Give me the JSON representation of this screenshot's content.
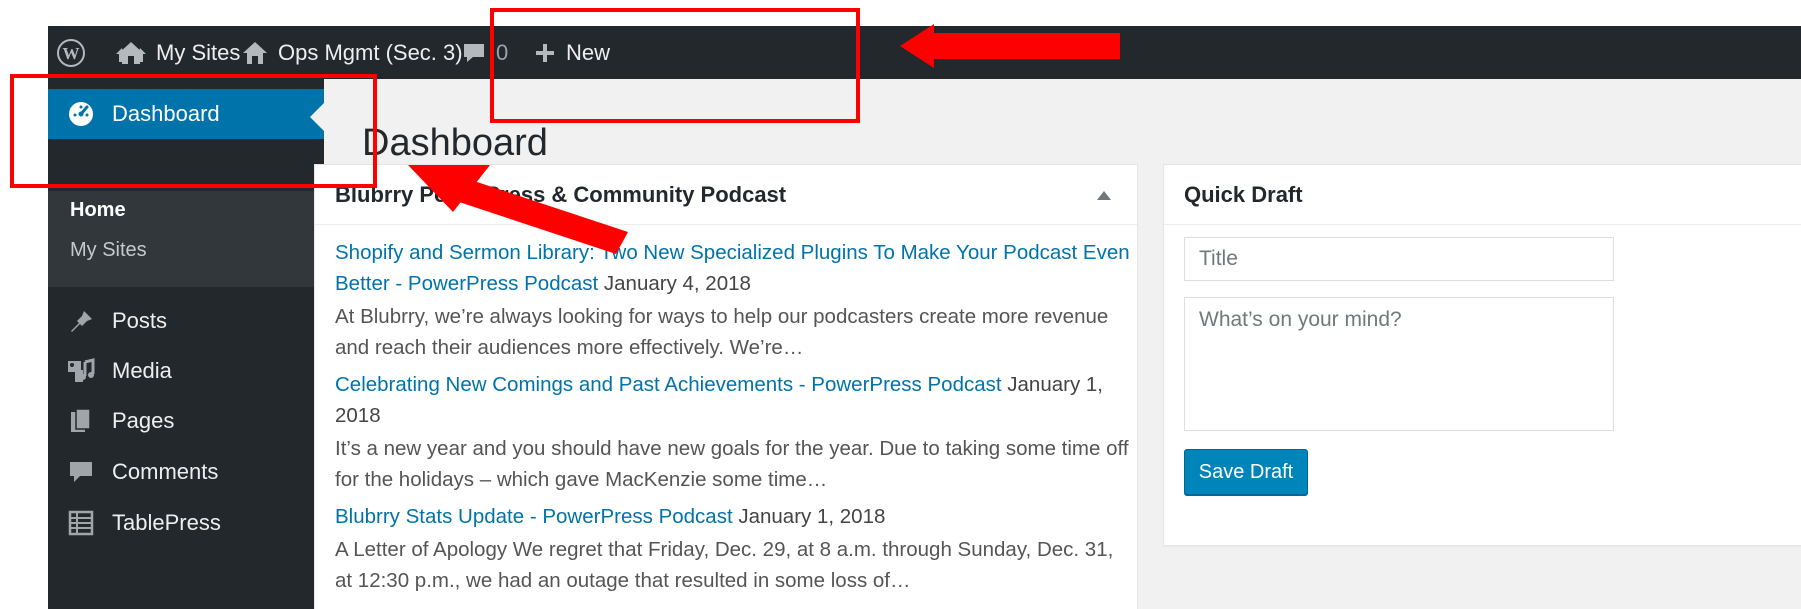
{
  "adminbar": {
    "my_sites": "My Sites",
    "site_name": "Ops Mgmt (Sec. 3)",
    "comments_count": "0",
    "new_label": "New"
  },
  "sidebar": {
    "dashboard": "Dashboard",
    "submenu": {
      "home": "Home",
      "my_sites": "My Sites"
    },
    "items": [
      {
        "label": "Posts",
        "icon": "pin-icon"
      },
      {
        "label": "Media",
        "icon": "media-icon"
      },
      {
        "label": "Pages",
        "icon": "pages-icon"
      },
      {
        "label": "Comments",
        "icon": "comment-icon"
      },
      {
        "label": "TablePress",
        "icon": "table-icon"
      }
    ]
  },
  "main": {
    "page_title": "Dashboard",
    "news_widget": {
      "title": "Blubrry PowerPress & Community Podcast",
      "items": [
        {
          "title": "Shopify and Sermon Library: Two New Specialized Plugins To Make Your Podcast Even Better - PowerPress Podcast",
          "date": "January 4, 2018",
          "summary": "At Blubrry, we’re always looking for ways to help our podcasters create more revenue and reach their audiences more effectively. We’re…"
        },
        {
          "title": "Celebrating New Comings and Past Achievements - PowerPress Podcast",
          "date": "January 1, 2018",
          "summary": "It’s a new year and you should have new goals for the year. Due to taking some time off for the holidays – which gave MacKenzie some time…"
        },
        {
          "title": "Blubrry Stats Update - PowerPress Podcast",
          "date": "January 1, 2018",
          "summary": "A Letter of Apology We regret that Friday, Dec. 29, at 8 a.m. through Sunday, Dec. 31, at 12:30 p.m., we had an outage that resulted in some loss of…"
        }
      ]
    },
    "quick_draft": {
      "title": "Quick Draft",
      "title_placeholder": "Title",
      "content_placeholder": "What’s on your mind?",
      "save_label": "Save Draft"
    }
  },
  "colors": {
    "adminbar_bg": "#23282d",
    "accent": "#0073aa",
    "button": "#0085ba",
    "annotation": "#ff0000"
  }
}
